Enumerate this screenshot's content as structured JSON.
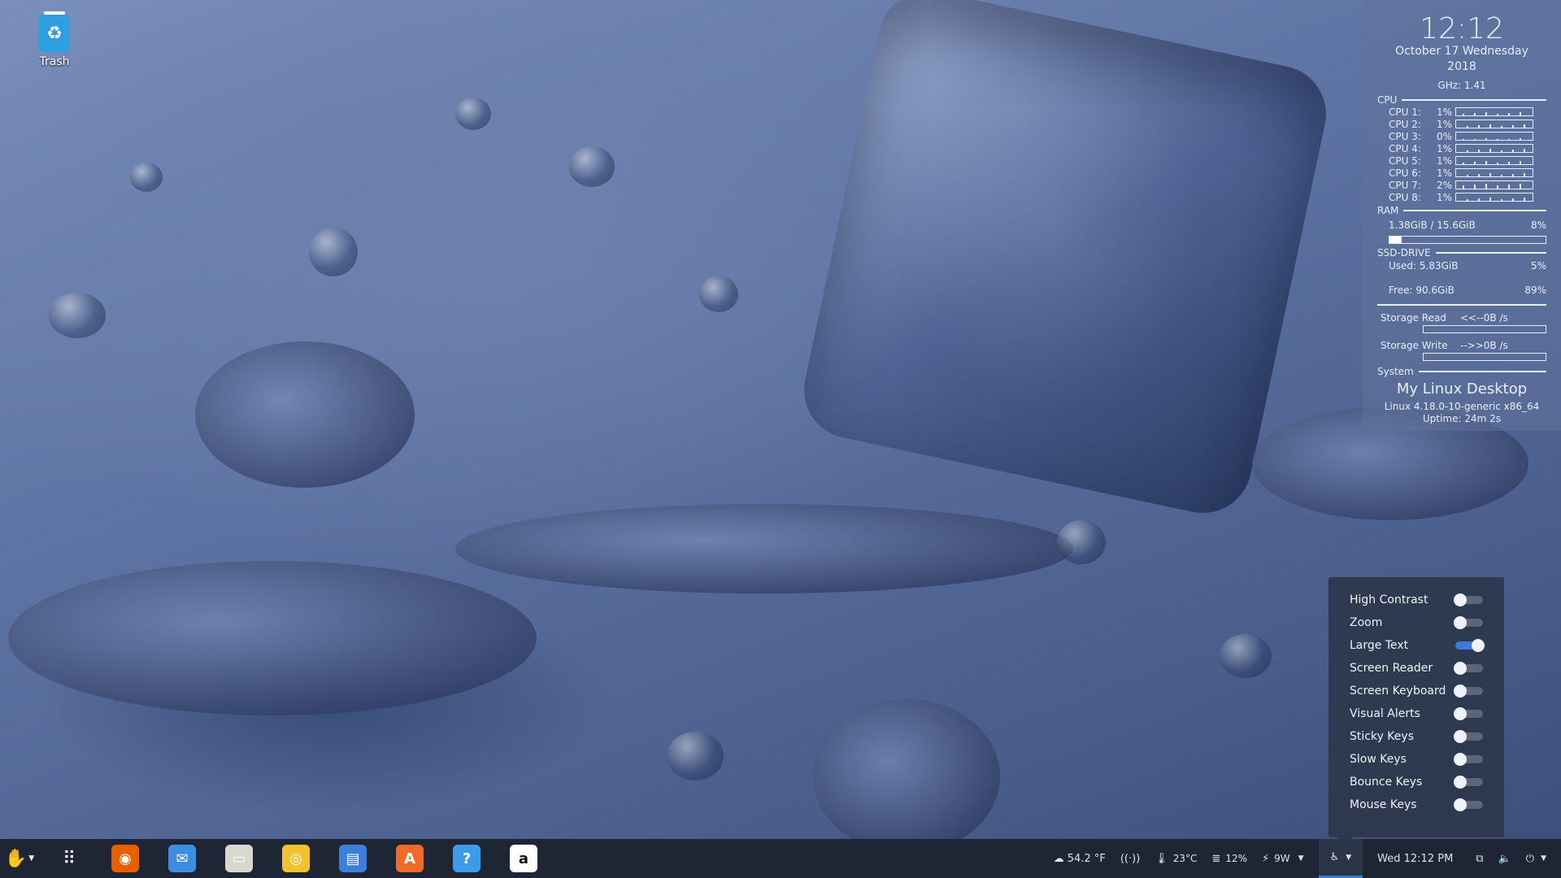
{
  "desktop": {
    "trash_label": "Trash"
  },
  "conky": {
    "time": "12:12",
    "date_line": "October 17 Wednesday",
    "year": "2018",
    "ghz": "GHz: 1.41",
    "cpu_title": "CPU",
    "cpus": [
      {
        "label": "CPU 1:",
        "pct": "1%"
      },
      {
        "label": "CPU 2:",
        "pct": "1%"
      },
      {
        "label": "CPU 3:",
        "pct": "0%"
      },
      {
        "label": "CPU 4:",
        "pct": "1%"
      },
      {
        "label": "CPU 5:",
        "pct": "1%"
      },
      {
        "label": "CPU 6:",
        "pct": "1%"
      },
      {
        "label": "CPU 7:",
        "pct": "2%"
      },
      {
        "label": "CPU 8:",
        "pct": "1%"
      }
    ],
    "ram_title": "RAM",
    "ram_used": "1.38GiB / 15.6GiB",
    "ram_pct": "8%",
    "ram_fraction": 0.08,
    "ssd_title": "SSD-DRIVE",
    "ssd_used_label": "Used:  5.83GiB",
    "ssd_used_pct": "5%",
    "ssd_free_label": "Free:  90.6GiB",
    "ssd_free_pct": "89%",
    "storage_read_label": "Storage Read",
    "storage_read_value": "<<--0B  /s",
    "storage_write_label": "Storage Write",
    "storage_write_value": "-->>0B  /s",
    "system_title": "System",
    "host": "My Linux Desktop",
    "kernel": "Linux 4.18.0-10-generic x86_64",
    "uptime": "Uptime: 24m 2s"
  },
  "accessibility": {
    "items": [
      {
        "label": "High Contrast",
        "on": false
      },
      {
        "label": "Zoom",
        "on": false
      },
      {
        "label": "Large Text",
        "on": true
      },
      {
        "label": "Screen Reader",
        "on": false
      },
      {
        "label": "Screen Keyboard",
        "on": false
      },
      {
        "label": "Visual Alerts",
        "on": false
      },
      {
        "label": "Sticky Keys",
        "on": false
      },
      {
        "label": "Slow Keys",
        "on": false
      },
      {
        "label": "Bounce Keys",
        "on": false
      },
      {
        "label": "Mouse Keys",
        "on": false
      }
    ]
  },
  "taskbar": {
    "apps": [
      {
        "name": "firefox-icon",
        "glyph": "◉",
        "color": "#e66000"
      },
      {
        "name": "mail-icon",
        "glyph": "✉",
        "color": "#3d8ee0"
      },
      {
        "name": "files-icon",
        "glyph": "▭",
        "color": "#d8d8d0"
      },
      {
        "name": "music-icon",
        "glyph": "◎",
        "color": "#f2c230"
      },
      {
        "name": "document-icon",
        "glyph": "▤",
        "color": "#3d7fd8"
      },
      {
        "name": "software-center-icon",
        "glyph": "A",
        "color": "#f06a2a"
      },
      {
        "name": "help-icon",
        "glyph": "?",
        "color": "#3d9be9"
      },
      {
        "name": "amazon-icon",
        "glyph": "a",
        "color": "#ffffff"
      }
    ],
    "tray": {
      "weather": "54.2 °F",
      "temp": "23°C",
      "disk_pct": "12%",
      "power": "9W",
      "datetime": "Wed 12:12 PM"
    }
  }
}
